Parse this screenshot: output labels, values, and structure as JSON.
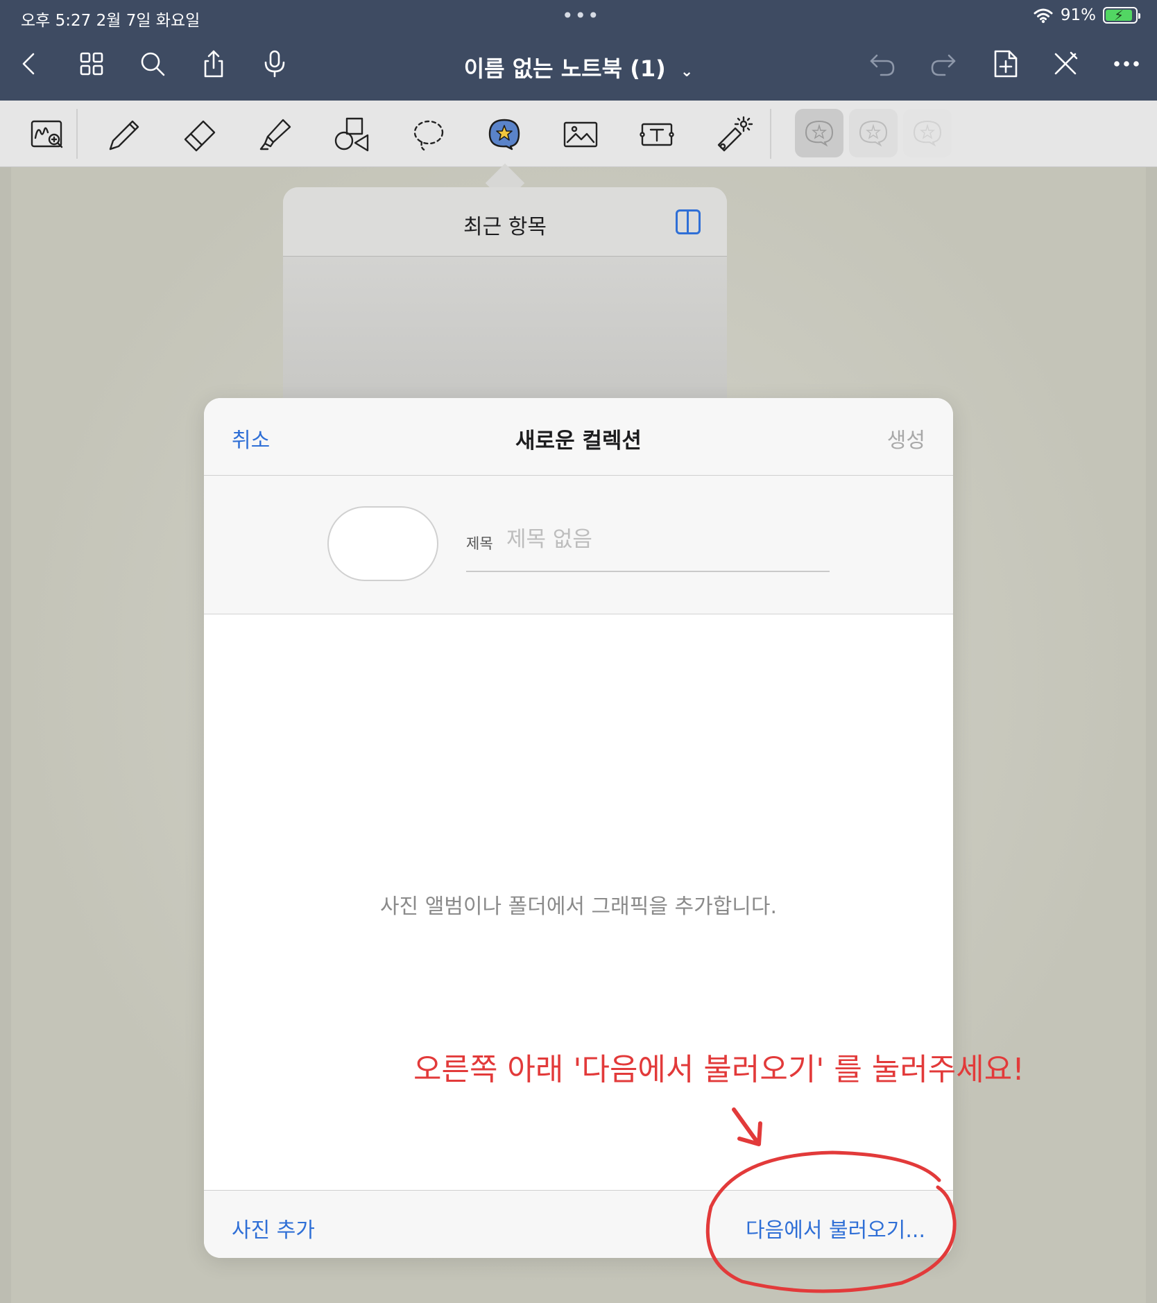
{
  "status_bar": {
    "time_date": "오후 5:27   2월 7일 화요일",
    "dots": "•••",
    "battery_percent": "91%",
    "battery_level": 0.91
  },
  "nav": {
    "doc_title": "이름 없는 노트북 (1)",
    "chevron": "⌄"
  },
  "toolbar": {
    "tools": [
      "zoom-window",
      "pen",
      "eraser",
      "highlighter",
      "shapes",
      "lasso",
      "sticker",
      "image",
      "text-box",
      "laser-pointer"
    ],
    "active_tool": "sticker"
  },
  "recent_popover": {
    "title": "최근 항목"
  },
  "modal": {
    "cancel_label": "취소",
    "title": "새로운 컬렉션",
    "create_label": "생성",
    "field_label": "제목",
    "field_placeholder": "제목 없음",
    "field_value": "",
    "empty_message": "사진 앨범이나 폴더에서 그래픽을 추가합니다.",
    "add_photo_label": "사진 추가",
    "import_label": "다음에서 불러오기..."
  },
  "annotation": {
    "text": "오른쪽 아래 '다음에서 불러오기' 를 눌러주세요!",
    "color": "#e23a3a"
  },
  "colors": {
    "nav_bg": "#3e4b62",
    "accent": "#2f6fd6"
  }
}
